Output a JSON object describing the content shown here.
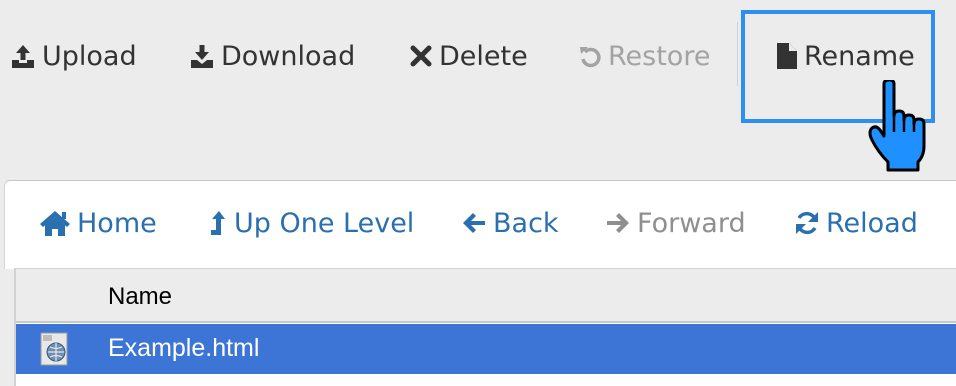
{
  "toolbar": {
    "upload": {
      "label": "Upload",
      "icon": "upload-icon"
    },
    "download": {
      "label": "Download",
      "icon": "download-icon"
    },
    "delete": {
      "label": "Delete",
      "icon": "delete-icon"
    },
    "restore": {
      "label": "Restore",
      "icon": "restore-icon",
      "disabled": true
    },
    "rename": {
      "label": "Rename",
      "icon": "file-icon",
      "highlighted": true
    }
  },
  "navbar": {
    "home": {
      "label": "Home",
      "icon": "home-icon"
    },
    "up": {
      "label": "Up One Level",
      "icon": "level-up-icon"
    },
    "back": {
      "label": "Back",
      "icon": "arrow-left-icon"
    },
    "forward": {
      "label": "Forward",
      "icon": "arrow-right-icon",
      "disabled": true
    },
    "reload": {
      "label": "Reload",
      "icon": "refresh-icon"
    }
  },
  "filelist": {
    "columns": [
      "Name"
    ],
    "rows": [
      {
        "name": "Example.html",
        "icon": "html-file-icon",
        "selected": true
      }
    ]
  },
  "colors": {
    "toolbar_bg": "#ececec",
    "text": "#333333",
    "disabled": "#a3a3a3",
    "nav_link": "#2a6faf",
    "highlight": "#2e8ff0",
    "selection": "#3d75d6",
    "cursor": "#1e90ff"
  },
  "cursor": {
    "icon": "hand-pointer-icon"
  }
}
